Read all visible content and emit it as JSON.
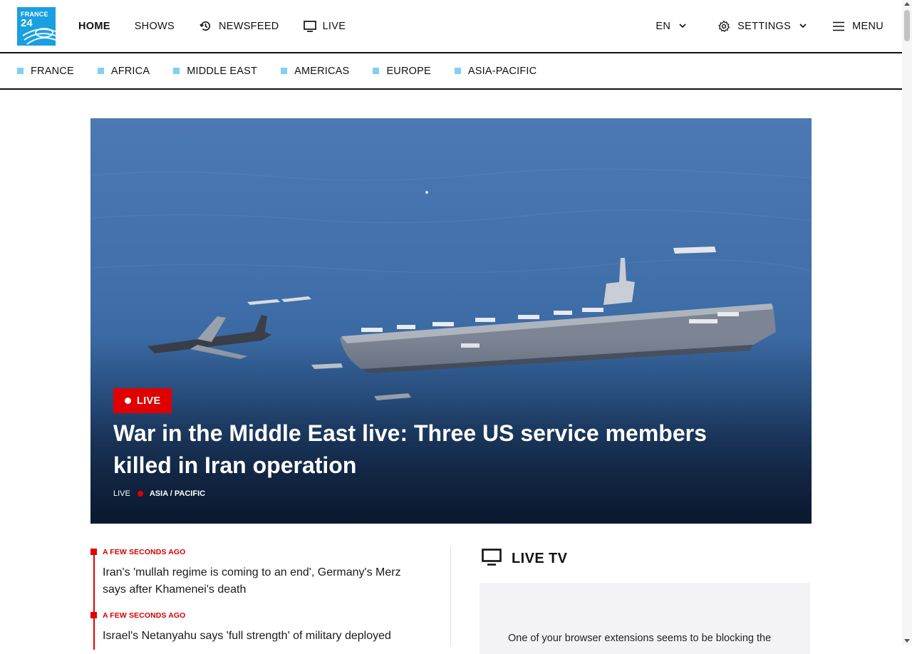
{
  "brand": {
    "logo_line1": "FRANCE",
    "logo_line2": "24",
    "color": "#1a9fe0"
  },
  "nav": {
    "home": "HOME",
    "shows": "SHOWS",
    "newsfeed": "NEWSFEED",
    "live": "LIVE",
    "language": "EN",
    "settings": "SETTINGS",
    "menu": "MENU"
  },
  "regions": [
    {
      "label": "FRANCE"
    },
    {
      "label": "AFRICA"
    },
    {
      "label": "MIDDLE EAST"
    },
    {
      "label": "AMERICAS"
    },
    {
      "label": "EUROPE"
    },
    {
      "label": "ASIA-PACIFIC"
    }
  ],
  "hero": {
    "badge": "LIVE",
    "title": "War in the Middle East live: Three US service members killed in Iran operation",
    "meta_label": "LIVE",
    "category": "ASIA / PACIFIC",
    "accent": "#e00000"
  },
  "feed": [
    {
      "time": "A FEW SECONDS AGO",
      "headline": "Iran's 'mullah regime is coming to an end', Germany's Merz says after Khamenei's death"
    },
    {
      "time": "A FEW SECONDS AGO",
      "headline": "Israel's Netanyahu says 'full strength' of military deployed"
    }
  ],
  "live_tv": {
    "title": "LIVE TV",
    "message": "One of your browser extensions seems to be blocking the"
  },
  "icons": {
    "newsfeed": "history-icon",
    "live": "monitor-icon",
    "settings": "gear-icon",
    "menu": "hamburger-icon",
    "dropdown": "chevron-down-icon"
  }
}
